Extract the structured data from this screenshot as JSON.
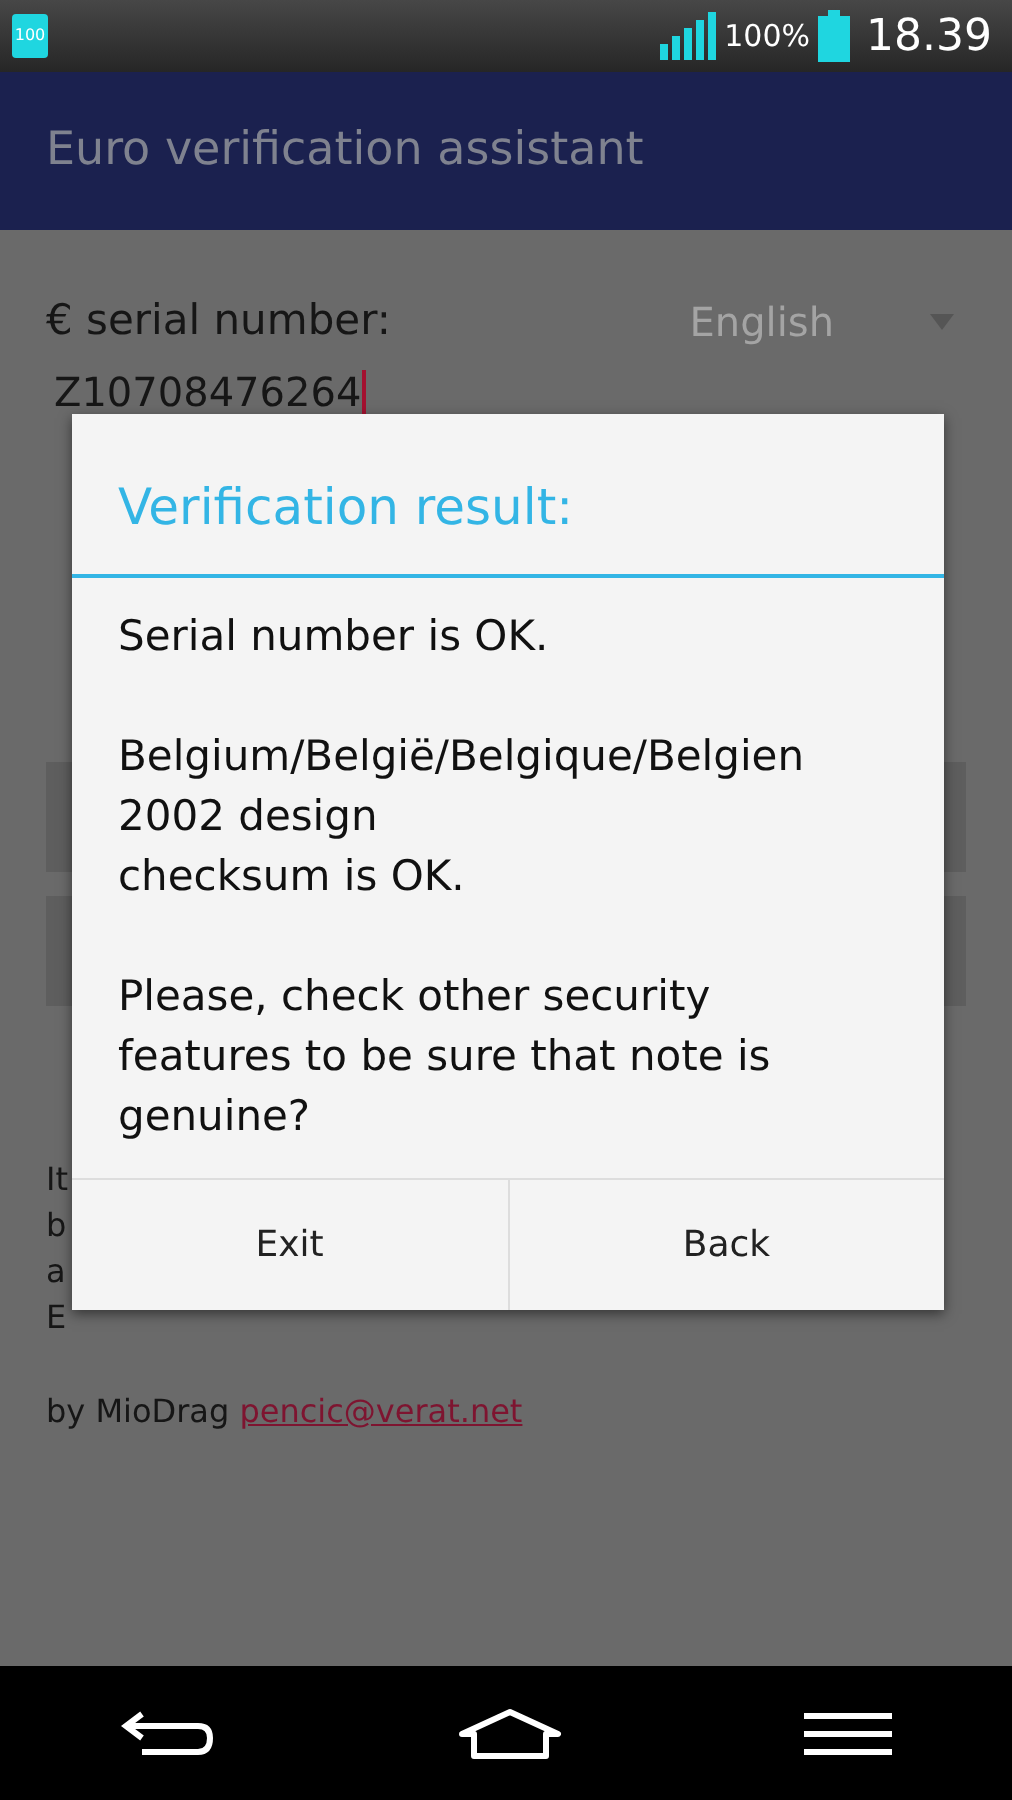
{
  "status_bar": {
    "notification": "100",
    "battery": "100%",
    "time": "18.39"
  },
  "app_bar": {
    "title": "Euro verification assistant"
  },
  "form": {
    "label": "€ serial number:",
    "language": "English",
    "serial": "Z10708476264"
  },
  "hidden_text_fragments": [
    "It",
    "b",
    "a",
    "E"
  ],
  "footer": {
    "author": "by MioDrag",
    "email": "pencic@verat.net"
  },
  "dialog": {
    "title": "Verification result:",
    "message": [
      "Serial number is OK.",
      "Belgium/België/Belgique/Belgien\n2002 design\nchecksum is OK.",
      "Please, check other security features to be sure that note is genuine?"
    ],
    "buttons": [
      {
        "label": "Exit"
      },
      {
        "label": "Back"
      }
    ]
  }
}
